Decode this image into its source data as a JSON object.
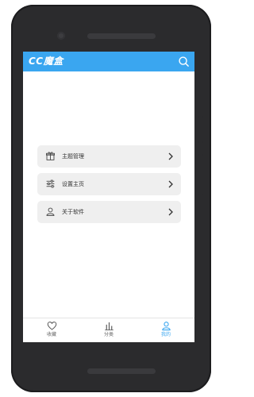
{
  "app": {
    "title": "CC魔盒"
  },
  "menu": {
    "items": [
      {
        "label": "主题管理",
        "icon": "gift-icon"
      },
      {
        "label": "设置主页",
        "icon": "sliders-icon"
      },
      {
        "label": "关于软件",
        "icon": "user-icon"
      }
    ]
  },
  "tabs": [
    {
      "label": "收藏",
      "icon": "heart-icon",
      "active": false
    },
    {
      "label": "分类",
      "icon": "bar-chart-icon",
      "active": false
    },
    {
      "label": "我的",
      "icon": "user-icon",
      "active": true
    }
  ],
  "colors": {
    "accent": "#3aa6f0",
    "item_bg": "#efefef",
    "phone": "#2b2b2d"
  }
}
